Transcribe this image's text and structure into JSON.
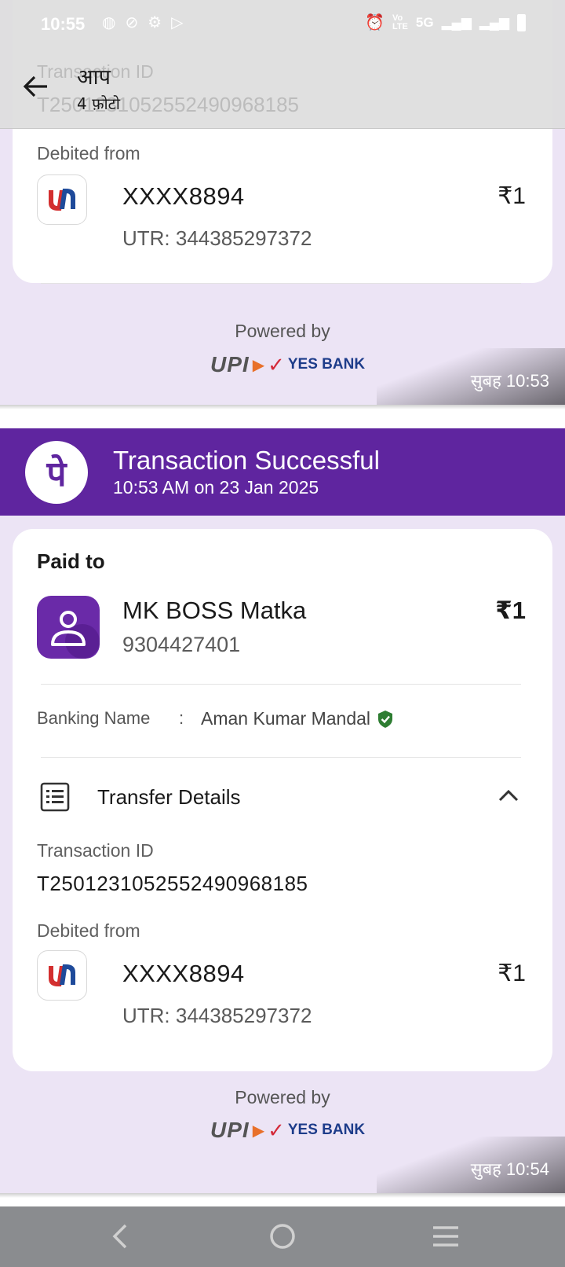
{
  "status_bar": {
    "time": "10:55",
    "left_icons": [
      "ms-icon",
      "compass-icon",
      "gear-icon",
      "play-icon"
    ],
    "right_text": "5G"
  },
  "header": {
    "title": "आप",
    "subtitle": "4 फ़ोटो",
    "ghost_label": "Transaction ID",
    "ghost_value": "T2501231052552490968185"
  },
  "message1": {
    "debited_label": "Debited from",
    "account": "XXXX8894",
    "utr": "UTR: 344385297372",
    "amount": "₹1",
    "powered_by": "Powered by",
    "upi": "UPI",
    "bank": "YES BANK",
    "timestamp": "सुबह 10:53"
  },
  "message2": {
    "banner_title": "Transaction Successful",
    "banner_subtitle": "10:53 AM on 23 Jan 2025",
    "paid_to_label": "Paid to",
    "payee_name": "MK BOSS Matka",
    "payee_phone": "9304427401",
    "amount": "₹1",
    "banking_name_label": "Banking Name",
    "banking_name_sep": ":",
    "banking_name_value": "Aman Kumar Mandal",
    "transfer_details_label": "Transfer Details",
    "transaction_id_label": "Transaction ID",
    "transaction_id_value": "T2501231052552490968185",
    "debited_label": "Debited from",
    "account": "XXXX8894",
    "account_amount": "₹1",
    "utr": "UTR: 344385297372",
    "powered_by": "Powered by",
    "upi": "UPI",
    "bank": "YES BANK",
    "timestamp": "सुबह 10:54"
  },
  "colors": {
    "brand": "#5f259f",
    "background": "#ece4f5",
    "verified": "#2e7d32",
    "union_red": "#d32f2f",
    "union_blue": "#1e4a9a"
  }
}
